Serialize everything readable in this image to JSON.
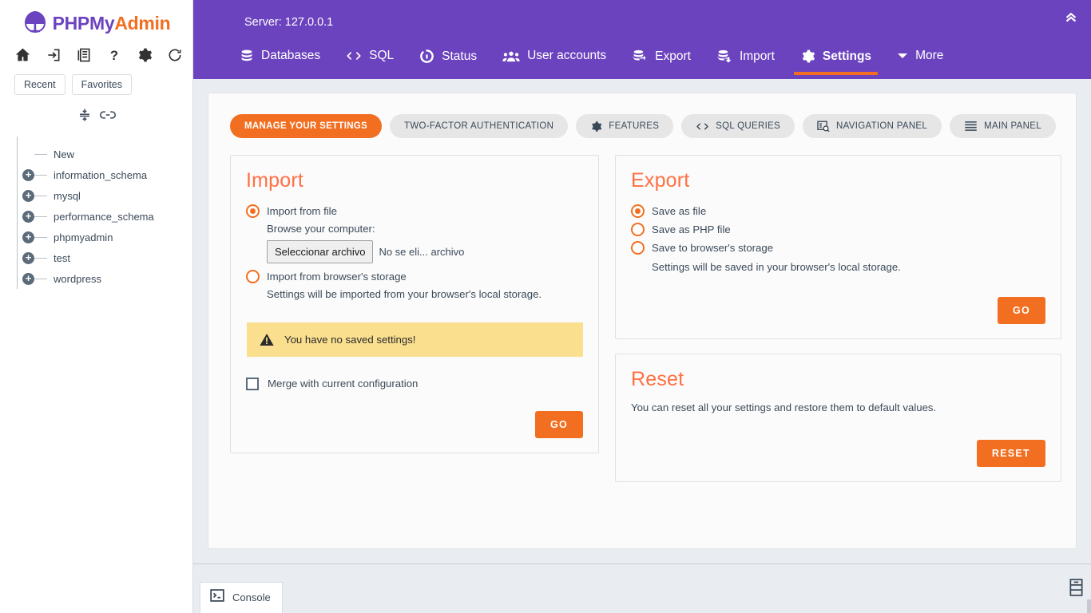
{
  "brand": {
    "php": "PHP",
    "my": "My",
    "admin": "Admin",
    "colors": {
      "purple": "#6c43bf",
      "orange": "#f26f21",
      "heading": "#ff7043",
      "warn_bg": "#fadf8e"
    }
  },
  "sidebar": {
    "icons": [
      {
        "name": "home-icon",
        "label": "Home"
      },
      {
        "name": "logout-icon",
        "label": "Log out"
      },
      {
        "name": "docs-icon",
        "label": "phpMyAdmin documentation"
      },
      {
        "name": "help-icon",
        "label": "Documentation"
      },
      {
        "name": "settings-icon",
        "label": "Navigation settings"
      },
      {
        "name": "reload-icon",
        "label": "Reload navigation"
      }
    ],
    "quick_buttons": [
      {
        "label": "Recent"
      },
      {
        "label": "Favorites"
      }
    ],
    "tree_tools": [
      {
        "name": "collapse-all-icon",
        "label": "Collapse all"
      },
      {
        "name": "link-tables-icon",
        "label": "Link with main panel"
      }
    ],
    "tree": [
      {
        "label": "New",
        "expandable": false
      },
      {
        "label": "information_schema",
        "expandable": true
      },
      {
        "label": "mysql",
        "expandable": true
      },
      {
        "label": "performance_schema",
        "expandable": true
      },
      {
        "label": "phpmyadmin",
        "expandable": true
      },
      {
        "label": "test",
        "expandable": true
      },
      {
        "label": "wordpress",
        "expandable": true
      }
    ]
  },
  "topnav": {
    "server_label": "Server: 127.0.0.1",
    "collapse_title": "Collapse navigation",
    "items": [
      {
        "label": "Databases",
        "icon": "database-icon",
        "active": false
      },
      {
        "label": "SQL",
        "icon": "code-icon",
        "active": false
      },
      {
        "label": "Status",
        "icon": "status-icon",
        "active": false
      },
      {
        "label": "User accounts",
        "icon": "users-icon",
        "active": false
      },
      {
        "label": "Export",
        "icon": "export-icon",
        "active": false
      },
      {
        "label": "Import",
        "icon": "import-icon",
        "active": false
      },
      {
        "label": "Settings",
        "icon": "gear-icon",
        "active": true
      },
      {
        "label": "More",
        "icon": "caret-down-icon",
        "active": false
      }
    ]
  },
  "settings_tabs": [
    {
      "label": "MANAGE YOUR SETTINGS",
      "icon": null,
      "active": true
    },
    {
      "label": "TWO-FACTOR AUTHENTICATION",
      "icon": null,
      "active": false
    },
    {
      "label": "FEATURES",
      "icon": "gear-icon",
      "active": false
    },
    {
      "label": "SQL QUERIES",
      "icon": "code-icon",
      "active": false
    },
    {
      "label": "NAVIGATION PANEL",
      "icon": "nav-panel-icon",
      "active": false
    },
    {
      "label": "MAIN PANEL",
      "icon": "main-panel-icon",
      "active": false
    }
  ],
  "import": {
    "title": "Import",
    "option_file": "Import from file",
    "browse_label": "Browse your computer:",
    "file_button": "Seleccionar archivo",
    "file_name": "No se eli... archivo",
    "option_storage": "Import from browser's storage",
    "storage_hint": "Settings will be imported from your browser's local storage.",
    "warning": "You have no saved settings!",
    "merge_label": "Merge with current configuration",
    "go_label": "GO"
  },
  "export": {
    "title": "Export",
    "options": [
      {
        "label": "Save as file",
        "checked": true
      },
      {
        "label": "Save as PHP file",
        "checked": false
      },
      {
        "label": "Save to browser's storage",
        "checked": false
      }
    ],
    "hint": "Settings will be saved in your browser's local storage.",
    "go_label": "GO"
  },
  "reset": {
    "title": "Reset",
    "description": "You can reset all your settings and restore them to default values.",
    "button_label": "RESET"
  },
  "footer": {
    "console_label": "Console",
    "server_icon": "server-icon"
  }
}
